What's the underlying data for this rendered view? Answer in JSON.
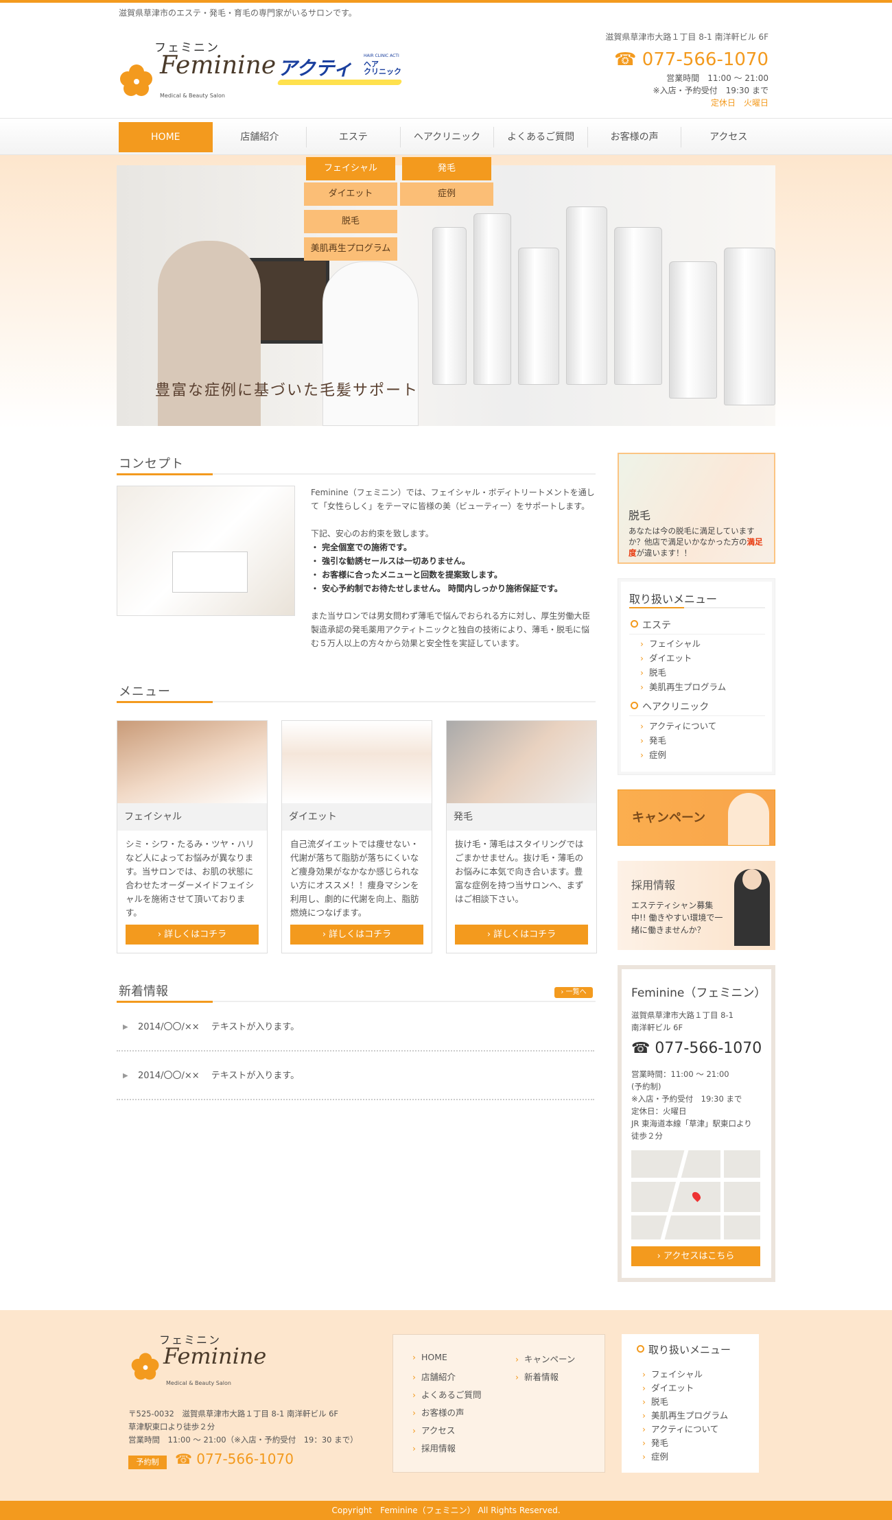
{
  "header": {
    "tagline": "滋賀県草津市のエステ・発毛・育毛の専門家がいるサロンです。",
    "logo_kana": "フェミニン",
    "logo_name": "Feminine",
    "logo_sub": "Medical & Beauty Salon",
    "acty_name": "アクティ",
    "acty_small": "HAIR CLINIC ACTI",
    "acty_sub1": "ヘア",
    "acty_sub2": "クリニック",
    "address": "滋賀県草津市大路１丁目 8-1 南洋軒ビル 6F",
    "tel": "☎ 077-566-1070",
    "hours": "営業時間　11:00 ～ 21:00",
    "reserve": "※入店・予約受付　19:30 まで",
    "closed": "定休日　火曜日"
  },
  "nav": {
    "items": [
      {
        "label": "HOME"
      },
      {
        "label": "店舗紹介"
      },
      {
        "label": "エステ"
      },
      {
        "label": "ヘアクリニック"
      },
      {
        "label": "よくあるご質問"
      },
      {
        "label": "お客様の声"
      },
      {
        "label": "アクセス"
      }
    ],
    "dropdown": {
      "esthe": [
        "フェイシャル",
        "ダイエット",
        "脱毛",
        "美肌再生プログラム"
      ],
      "hair": [
        "発毛",
        "症例"
      ]
    }
  },
  "hero": {
    "caption": "豊富な症例に基づいた毛髪サポート"
  },
  "concept": {
    "title": "コンセプト",
    "p1": "Feminine（フェミニン）では、フェイシャル・ボディトリートメントを通して「女性らしく」をテーマに皆様の美（ビューティー）をサポートします。",
    "intro": "下記、安心のお約束を致します。",
    "promises": [
      "・ 完全個室での施術です。",
      "・ 強引な勧誘セールスは一切ありません。",
      "・ お客様に合ったメニューと回数を提案致します。",
      "・ 安心予約制でお待たせしません。 時間内しっかり施術保証です。"
    ],
    "p3": "また当サロンでは男女問わず薄毛で悩んでおられる方に対し、厚生労働大臣製造承認の発毛薬用アクティトニックと独自の技術により、薄毛・脱毛に悩む５万人以上の方々から効果と安全性を実証しています。"
  },
  "menu": {
    "title": "メニュー",
    "cards": [
      {
        "label": "フェイシャル",
        "desc": "シミ・シワ・たるみ・ツヤ・ハリなど人によってお悩みが異なります。当サロンでは、お肌の状態に合わせたオーダーメイドフェイシャルを施術させて頂いております。",
        "button": "詳しくはコチラ"
      },
      {
        "label": "ダイエット",
        "desc": "自己流ダイエットでは痩せない・代謝が落ちて脂肪が落ちにくいなど痩身効果がなかなか感じられない方にオススメ！！痩身マシンを利用し、劇的に代謝を向上、脂肪燃焼につなげます。",
        "button": "詳しくはコチラ"
      },
      {
        "label": "発毛",
        "desc": "抜け毛・薄毛はスタイリングではごまかせません。抜け毛・薄毛のお悩みに本気で向き合います。豊富な症例を持つ当サロンへ、まずはご相談下さい。",
        "button": "詳しくはコチラ"
      }
    ]
  },
  "news": {
    "title": "新着情報",
    "all": "一覧へ",
    "items": [
      "2014/〇〇/×× 　テキストが入ります。",
      "2014/〇〇/×× 　テキストが入ります。"
    ]
  },
  "sidebar": {
    "hair_banner": {
      "title": "脱毛",
      "desc_a": "あなたは今の脱毛に満足していますか？他店で満足いかなかった方の",
      "desc_em": "満足度",
      "desc_b": "が違います！！"
    },
    "menu": {
      "title": "取り扱いメニュー",
      "esthe": "エステ",
      "esthe_items": [
        "フェイシャル",
        "ダイエット",
        "脱毛",
        "美肌再生プログラム"
      ],
      "hair": "ヘアクリニック",
      "hair_items": [
        "アクティについて",
        "発毛",
        "症例"
      ]
    },
    "campaign": "キャンペーン",
    "recruit": {
      "title": "採用情報",
      "desc": "エステティシャン募集中!! 働きやすい環境で一緒に働きませんか？"
    },
    "shop": {
      "title": "Feminine（フェミニン）",
      "addr1": "滋賀県草津市大路１丁目 8-1",
      "addr2": "南洋軒ビル 6F",
      "tel": "☎ 077-566-1070",
      "info": [
        "営業時間：11:00 ～ 21:00",
        "(予約制)",
        "※入店・予約受付　19:30 まで",
        "定休日：火曜日",
        "JR 東海道本線「草津」駅東口より",
        "徒歩２分"
      ],
      "button": "アクセスはこちら"
    }
  },
  "footer": {
    "logo_kana": "フェミニン",
    "logo_name": "Feminine",
    "logo_sub": "Medical & Beauty Salon",
    "addr": [
      "〒525-0032　滋賀県草津市大路１丁目 8-1 南洋軒ビル 6F",
      "草津駅東口より徒歩２分",
      "営業時間　11:00 ～ 21:00（※入店・予約受付　19：30 まで）"
    ],
    "reserve": "予約制",
    "tel": "☎ 077-566-1070",
    "links_left": [
      "HOME",
      "店舗紹介",
      "よくあるご質問",
      "お客様の声",
      "アクセス",
      "採用情報"
    ],
    "links_right": [
      "キャンペーン",
      "新着情報"
    ],
    "menu_title": "取り扱いメニュー",
    "menu_items": [
      "フェイシャル",
      "ダイエット",
      "脱毛",
      "美肌再生プログラム",
      "アクティについて",
      "発毛",
      "症例"
    ],
    "copyright": "Copyright　Feminine（フェミニン）  All Rights Reserved."
  },
  "colors": {
    "accent": "#f39a1e",
    "band": "#fde6cd"
  }
}
